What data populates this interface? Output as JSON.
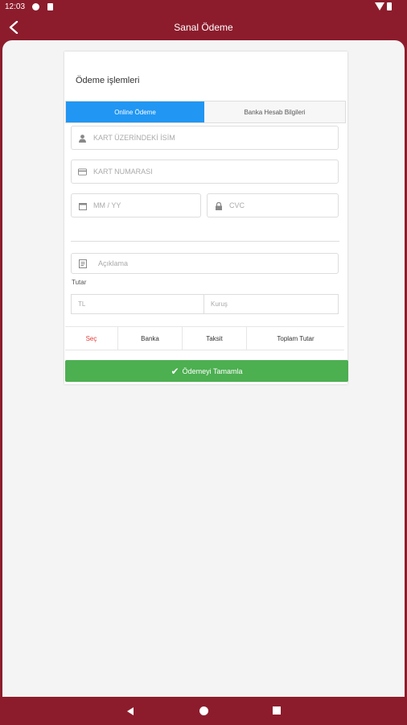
{
  "status_bar": {
    "time": "12:03",
    "icons": [
      "p-icon",
      "sim-card-icon",
      "wifi-icon",
      "battery-icon"
    ]
  },
  "app_bar": {
    "back_icon": "arrow-left-icon",
    "title": "Sanal Ödeme"
  },
  "card": {
    "title": "Ödeme işlemleri",
    "tabs": [
      {
        "label": "Online Ödeme",
        "active": true
      },
      {
        "label": "Banka Hesab Bilgileri",
        "active": false
      }
    ],
    "fields": {
      "name": {
        "placeholder": "KART ÜZERİNDEKİ İSİM",
        "icon": "user-icon",
        "value": ""
      },
      "card_number": {
        "placeholder": "KART NUMARASI",
        "icon": "credit-card-icon",
        "value": ""
      },
      "expiry": {
        "placeholder": "MM / YY",
        "icon": "calendar-icon",
        "value": ""
      },
      "cvc": {
        "placeholder": "CVC",
        "icon": "lock-icon",
        "value": ""
      },
      "description": {
        "placeholder": "Açıklama",
        "icon": "note-icon",
        "value": ""
      }
    },
    "tutar_label": "Tutar",
    "amount": {
      "tl_placeholder": "TL",
      "kurus_placeholder": "Kuruş"
    },
    "bank_table": {
      "columns": [
        "Seç",
        "Banka",
        "Taksit",
        "Toplam Tutar"
      ]
    }
  },
  "submit_button": {
    "label": "Ödemeyi Tamamla",
    "icon": "check-icon"
  },
  "colors": {
    "brand": "#8c1c2c",
    "tab_active": "#2196f3",
    "submit": "#4caf50",
    "select_text": "#e53935"
  }
}
